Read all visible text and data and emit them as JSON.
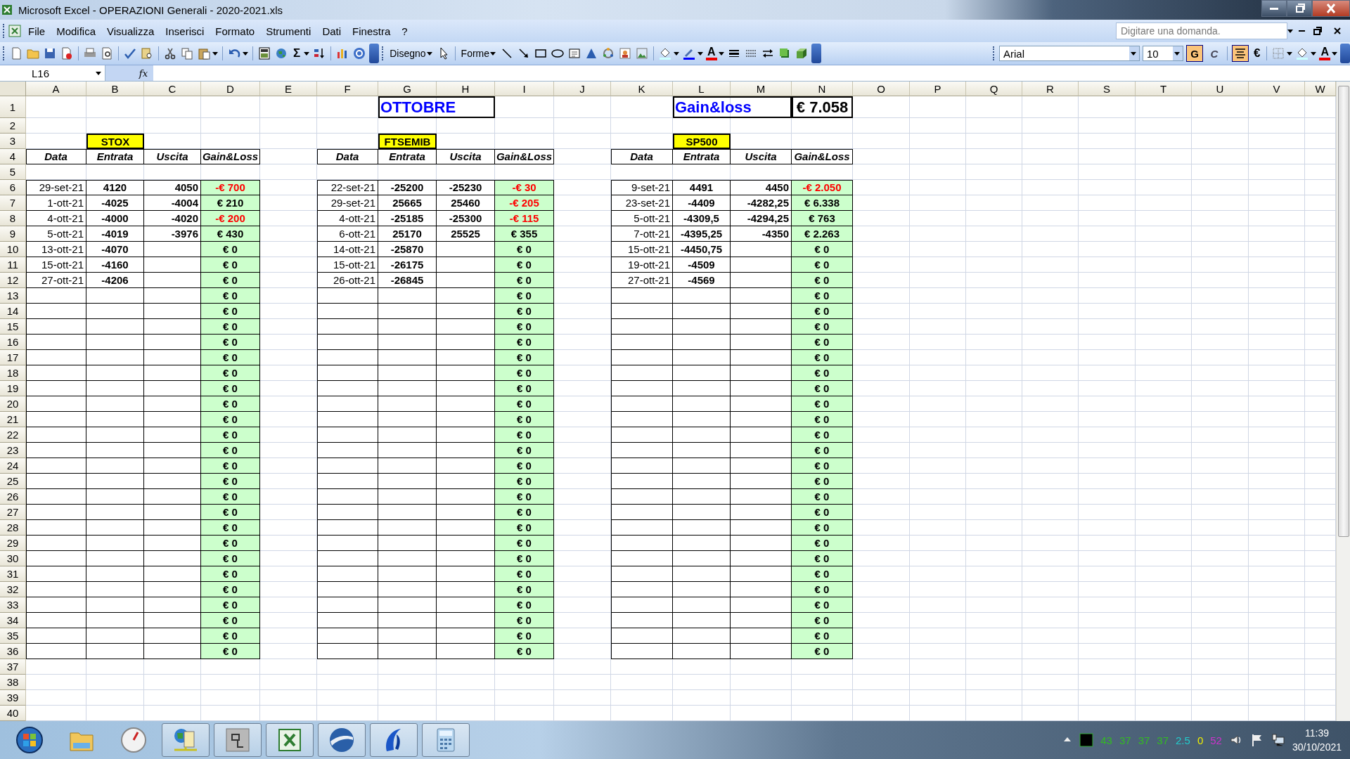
{
  "window": {
    "title": "Microsoft Excel - OPERAZIONI Generali - 2020-2021.xls"
  },
  "menu": [
    "File",
    "Modifica",
    "Visualizza",
    "Inserisci",
    "Formato",
    "Strumenti",
    "Dati",
    "Finestra",
    "?"
  ],
  "help_search": {
    "placeholder": "Digitare una domanda."
  },
  "toolbar": {
    "sum": "Σ",
    "drawing": "Disegno",
    "shapes": "Forme",
    "drawing_font_color": "A",
    "font": "Arial",
    "size": "10",
    "bold": {
      "label": "G",
      "on": true
    },
    "italic": {
      "label": "C",
      "on": false
    },
    "align_center": {
      "on": true
    },
    "euro": "€",
    "font_color": "A"
  },
  "formula_bar": {
    "name_box": "L16",
    "fx": "fx"
  },
  "sheet": {
    "columns": [
      "A",
      "B",
      "C",
      "D",
      "E",
      "F",
      "G",
      "H",
      "I",
      "J",
      "K",
      "L",
      "M",
      "N",
      "O",
      "P",
      "Q",
      "R",
      "S",
      "T",
      "U",
      "V",
      "W"
    ],
    "row_numbers": [
      "1",
      "2",
      "3",
      "4",
      "5",
      "6",
      "7",
      "8",
      "9",
      "10",
      "11",
      "12",
      "13",
      "14",
      "15",
      "16",
      "17",
      "18",
      "19",
      "20",
      "21",
      "22",
      "23",
      "24",
      "25",
      "26",
      "27",
      "28",
      "29",
      "30",
      "31",
      "32",
      "33",
      "34",
      "35",
      "36",
      "37",
      "38",
      "39",
      "40"
    ],
    "month": "OTTOBRE",
    "total_label": "Gain&loss",
    "total": "€ 7.058",
    "tables": [
      {
        "label": "STOX",
        "headers": [
          "Data",
          "Entrata",
          "Uscita",
          "Gain&Loss"
        ],
        "rows": [
          {
            "data": "29-set-21",
            "entrata": "4120",
            "uscita": "4050",
            "gain_loss": "-€ 700",
            "negative": true
          },
          {
            "data": "1-ott-21",
            "entrata": "-4025",
            "uscita": "-4004",
            "gain_loss": "€ 210",
            "negative": false
          },
          {
            "data": "4-ott-21",
            "entrata": "-4000",
            "uscita": "-4020",
            "gain_loss": "-€ 200",
            "negative": true
          },
          {
            "data": "5-ott-21",
            "entrata": "-4019",
            "uscita": "-3976",
            "gain_loss": "€ 430",
            "negative": false
          },
          {
            "data": "13-ott-21",
            "entrata": "-4070",
            "gain_loss": "€ 0",
            "negative": false
          },
          {
            "data": "15-ott-21",
            "entrata": "-4160",
            "gain_loss": "€ 0",
            "negative": false
          },
          {
            "data": "27-ott-21",
            "entrata": "-4206",
            "gain_loss": "€ 0",
            "negative": false
          },
          {
            "gain_loss": "€ 0",
            "negative": false
          },
          {
            "gain_loss": "€ 0",
            "negative": false
          },
          {
            "gain_loss": "€ 0",
            "negative": false
          },
          {
            "gain_loss": "€ 0",
            "negative": false
          },
          {
            "gain_loss": "€ 0",
            "negative": false
          },
          {
            "gain_loss": "€ 0",
            "negative": false
          },
          {
            "gain_loss": "€ 0",
            "negative": false
          },
          {
            "gain_loss": "€ 0",
            "negative": false
          },
          {
            "gain_loss": "€ 0",
            "negative": false
          },
          {
            "gain_loss": "€ 0",
            "negative": false
          },
          {
            "gain_loss": "€ 0",
            "negative": false
          },
          {
            "gain_loss": "€ 0",
            "negative": false
          },
          {
            "gain_loss": "€ 0",
            "negative": false
          },
          {
            "gain_loss": "€ 0",
            "negative": false
          },
          {
            "gain_loss": "€ 0",
            "negative": false
          },
          {
            "gain_loss": "€ 0",
            "negative": false
          },
          {
            "gain_loss": "€ 0",
            "negative": false
          },
          {
            "gain_loss": "€ 0",
            "negative": false
          },
          {
            "gain_loss": "€ 0",
            "negative": false
          },
          {
            "gain_loss": "€ 0",
            "negative": false
          },
          {
            "gain_loss": "€ 0",
            "negative": false
          },
          {
            "gain_loss": "€ 0",
            "negative": false
          },
          {
            "gain_loss": "€ 0",
            "negative": false
          },
          {
            "gain_loss": "€ 0",
            "negative": false
          }
        ]
      },
      {
        "label": "FTSEMIB",
        "headers": [
          "Data",
          "Entrata",
          "Uscita",
          "Gain&Loss"
        ],
        "rows": [
          {
            "data": "22-set-21",
            "entrata": "-25200",
            "uscita": "-25230",
            "gain_loss": "-€ 30",
            "negative": true
          },
          {
            "data": "29-set-21",
            "entrata": "25665",
            "uscita": "25460",
            "gain_loss": "-€ 205",
            "negative": true
          },
          {
            "data": "4-ott-21",
            "entrata": "-25185",
            "uscita": "-25300",
            "gain_loss": "-€ 115",
            "negative": true
          },
          {
            "data": "6-ott-21",
            "entrata": "25170",
            "uscita": "25525",
            "gain_loss": "€ 355",
            "negative": false
          },
          {
            "data": "14-ott-21",
            "entrata": "-25870",
            "gain_loss": "€ 0",
            "negative": false
          },
          {
            "data": "15-ott-21",
            "entrata": "-26175",
            "gain_loss": "€ 0",
            "negative": false
          },
          {
            "data": "26-ott-21",
            "entrata": "-26845",
            "gain_loss": "€ 0",
            "negative": false
          },
          {
            "gain_loss": "€ 0",
            "negative": false
          },
          {
            "gain_loss": "€ 0",
            "negative": false
          },
          {
            "gain_loss": "€ 0",
            "negative": false
          },
          {
            "gain_loss": "€ 0",
            "negative": false
          },
          {
            "gain_loss": "€ 0",
            "negative": false
          },
          {
            "gain_loss": "€ 0",
            "negative": false
          },
          {
            "gain_loss": "€ 0",
            "negative": false
          },
          {
            "gain_loss": "€ 0",
            "negative": false
          },
          {
            "gain_loss": "€ 0",
            "negative": false
          },
          {
            "gain_loss": "€ 0",
            "negative": false
          },
          {
            "gain_loss": "€ 0",
            "negative": false
          },
          {
            "gain_loss": "€ 0",
            "negative": false
          },
          {
            "gain_loss": "€ 0",
            "negative": false
          },
          {
            "gain_loss": "€ 0",
            "negative": false
          },
          {
            "gain_loss": "€ 0",
            "negative": false
          },
          {
            "gain_loss": "€ 0",
            "negative": false
          },
          {
            "gain_loss": "€ 0",
            "negative": false
          },
          {
            "gain_loss": "€ 0",
            "negative": false
          },
          {
            "gain_loss": "€ 0",
            "negative": false
          },
          {
            "gain_loss": "€ 0",
            "negative": false
          },
          {
            "gain_loss": "€ 0",
            "negative": false
          },
          {
            "gain_loss": "€ 0",
            "negative": false
          },
          {
            "gain_loss": "€ 0",
            "negative": false
          },
          {
            "gain_loss": "€ 0",
            "negative": false
          }
        ]
      },
      {
        "label": "SP500",
        "headers": [
          "Data",
          "Entrata",
          "Uscita",
          "Gain&Loss"
        ],
        "rows": [
          {
            "data": "9-set-21",
            "entrata": "4491",
            "uscita": "4450",
            "gain_loss": "-€ 2.050",
            "negative": true
          },
          {
            "data": "23-set-21",
            "entrata": "-4409",
            "uscita": "-4282,25",
            "gain_loss": "€ 6.338",
            "negative": false
          },
          {
            "data": "5-ott-21",
            "entrata": "-4309,5",
            "uscita": "-4294,25",
            "gain_loss": "€ 763",
            "negative": false
          },
          {
            "data": "7-ott-21",
            "entrata": "-4395,25",
            "uscita": "-4350",
            "gain_loss": "€ 2.263",
            "negative": false
          },
          {
            "data": "15-ott-21",
            "entrata": "-4450,75",
            "gain_loss": "€ 0",
            "negative": false
          },
          {
            "data": "19-ott-21",
            "entrata": "-4509",
            "gain_loss": "€ 0",
            "negative": false
          },
          {
            "data": "27-ott-21",
            "entrata": "-4569",
            "gain_loss": "€ 0",
            "negative": false
          },
          {
            "gain_loss": "€ 0",
            "negative": false
          },
          {
            "gain_loss": "€ 0",
            "negative": false
          },
          {
            "gain_loss": "€ 0",
            "negative": false
          },
          {
            "gain_loss": "€ 0",
            "negative": false
          },
          {
            "gain_loss": "€ 0",
            "negative": false
          },
          {
            "gain_loss": "€ 0",
            "negative": false
          },
          {
            "gain_loss": "€ 0",
            "negative": false
          },
          {
            "gain_loss": "€ 0",
            "negative": false
          },
          {
            "gain_loss": "€ 0",
            "negative": false
          },
          {
            "gain_loss": "€ 0",
            "negative": false
          },
          {
            "gain_loss": "€ 0",
            "negative": false
          },
          {
            "gain_loss": "€ 0",
            "negative": false
          },
          {
            "gain_loss": "€ 0",
            "negative": false
          },
          {
            "gain_loss": "€ 0",
            "negative": false
          },
          {
            "gain_loss": "€ 0",
            "negative": false
          },
          {
            "gain_loss": "€ 0",
            "negative": false
          },
          {
            "gain_loss": "€ 0",
            "negative": false
          },
          {
            "gain_loss": "€ 0",
            "negative": false
          },
          {
            "gain_loss": "€ 0",
            "negative": false
          },
          {
            "gain_loss": "€ 0",
            "negative": false
          },
          {
            "gain_loss": "€ 0",
            "negative": false
          },
          {
            "gain_loss": "€ 0",
            "negative": false
          },
          {
            "gain_loss": "€ 0",
            "negative": false
          },
          {
            "gain_loss": "€ 0",
            "negative": false
          }
        ]
      }
    ]
  },
  "taskbar": {
    "tray_readings": [
      {
        "text": "43",
        "color": "#33bb22"
      },
      {
        "text": "37",
        "color": "#33bb22"
      },
      {
        "text": "37",
        "color": "#33bb22"
      },
      {
        "text": "37",
        "color": "#33bb22"
      },
      {
        "text": "2.5",
        "color": "#22cccc"
      },
      {
        "text": "0",
        "color": "#eeee00"
      },
      {
        "text": "52",
        "color": "#cc33cc"
      }
    ],
    "time": "11:39",
    "date": "30/10/2021"
  }
}
